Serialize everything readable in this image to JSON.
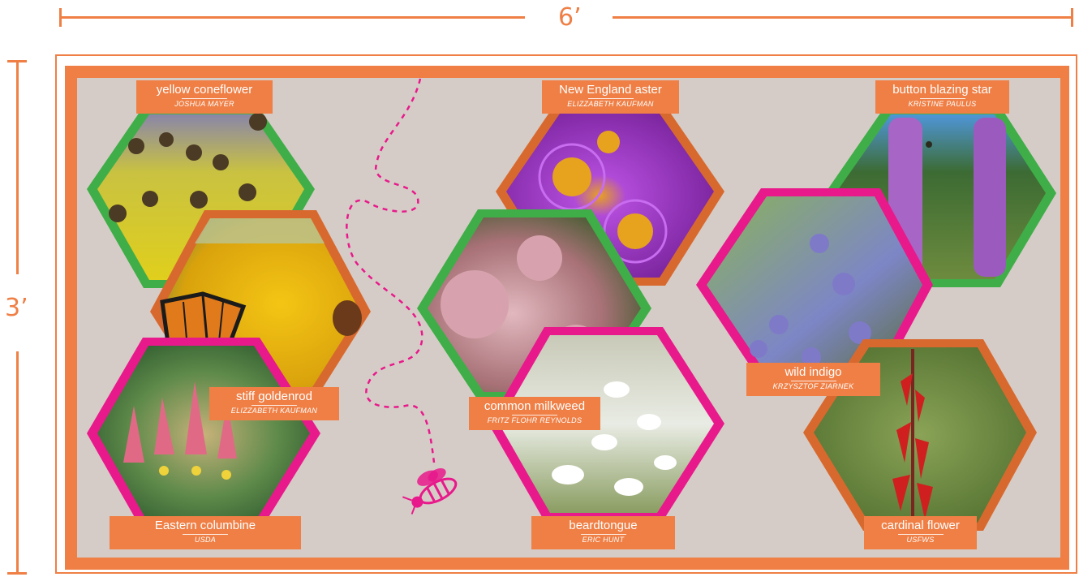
{
  "dimensions": {
    "width_label": "6’",
    "height_label": "3’"
  },
  "colors": {
    "frame": "#ef7f45",
    "board": "#d6ccc7",
    "green": "#3fae48",
    "pink": "#e8198b",
    "orange_dark": "#d8692e",
    "magenta": "#e8198b"
  },
  "plants": [
    {
      "name": "yellow coneflower",
      "credit": "JOSHUA MAYER"
    },
    {
      "name": "New England aster",
      "credit": "ELIZZABETH KAUFMAN"
    },
    {
      "name": "button blazing star",
      "credit": "KRISTINE PAULUS"
    },
    {
      "name": "stiff goldenrod",
      "credit": "ELIZZABETH KAUFMAN"
    },
    {
      "name": "common milkweed",
      "credit": "FRITZ FLOHR REYNOLDS"
    },
    {
      "name": "wild indigo",
      "credit": "KRZYSZTOF ZIARNEK"
    },
    {
      "name": "Eastern columbine",
      "credit": "USDA"
    },
    {
      "name": "beardtongue",
      "credit": "ERIC HUNT"
    },
    {
      "name": "cardinal flower",
      "credit": "USFWS"
    }
  ],
  "icons": {
    "bee": "bee-icon",
    "flight_path": "dashed-flight-path"
  }
}
